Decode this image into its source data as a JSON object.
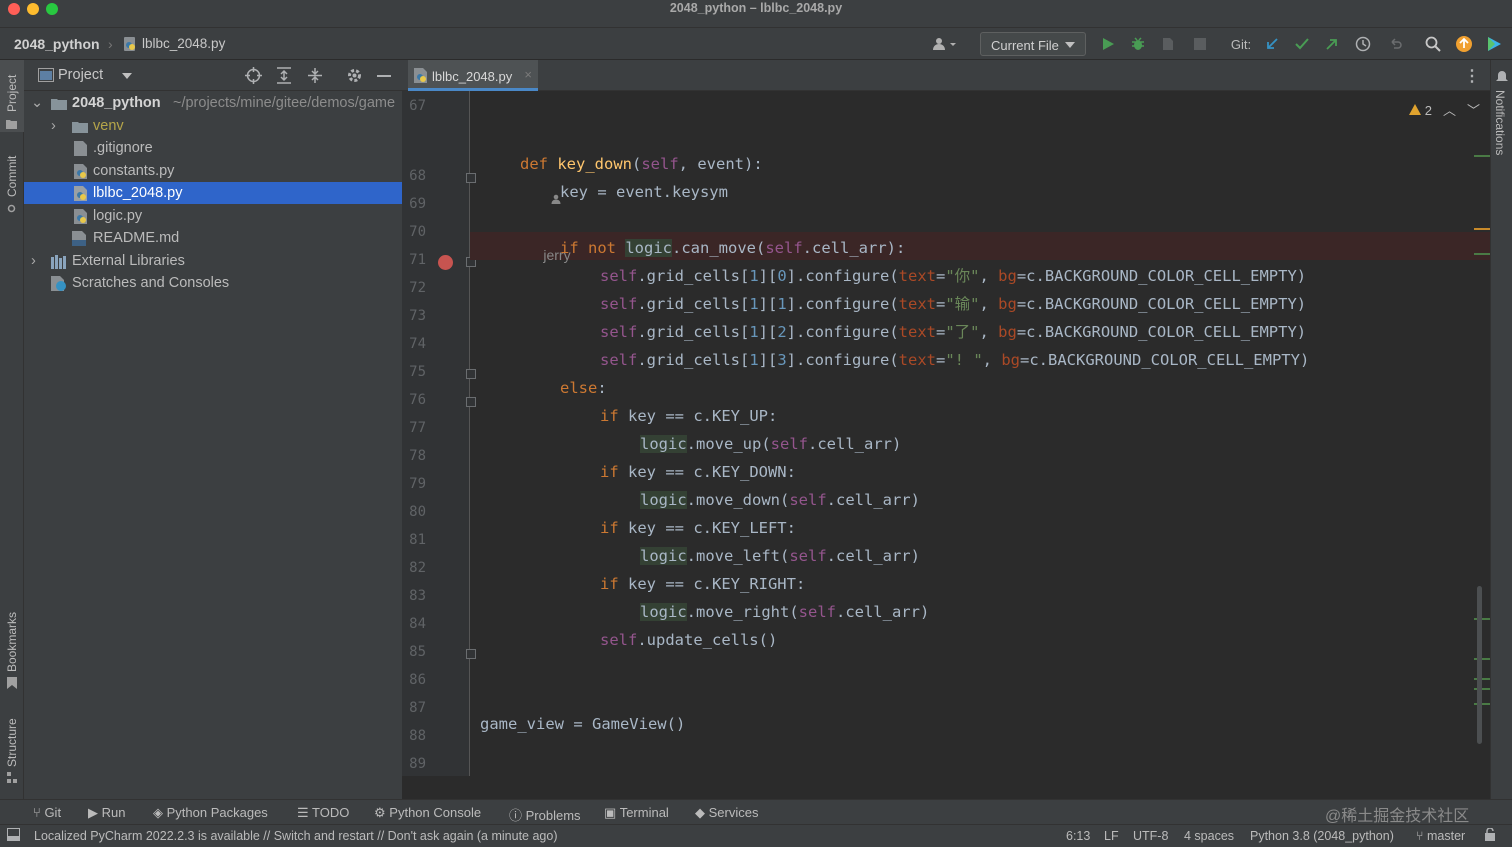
{
  "window": {
    "title": "2048_python – lblbc_2048.py"
  },
  "nav": {
    "project": "2048_python",
    "file": "lblbc_2048.py",
    "run_config": "Current File",
    "git_label": "Git:"
  },
  "project_panel": {
    "title": "Project",
    "tree": [
      {
        "label": "2048_python",
        "path": "~/projects/mine/gitee/demos/game",
        "type": "root"
      },
      {
        "label": "venv",
        "type": "folder"
      },
      {
        "label": ".gitignore",
        "type": "file"
      },
      {
        "label": "constants.py",
        "type": "py"
      },
      {
        "label": "lblbc_2048.py",
        "type": "py",
        "selected": true
      },
      {
        "label": "logic.py",
        "type": "py"
      },
      {
        "label": "README.md",
        "type": "md"
      },
      {
        "label": "External Libraries",
        "type": "lib"
      },
      {
        "label": "Scratches and Consoles",
        "type": "scratch"
      }
    ]
  },
  "left_strip": {
    "project": "Project",
    "commit": "Commit",
    "bookmarks": "Bookmarks",
    "structure": "Structure"
  },
  "right_strip": {
    "notifications": "Notifications"
  },
  "editor": {
    "tab": "lblbc_2048.py",
    "warnings": "2",
    "author_hint": "jerry",
    "line_numbers": [
      "67",
      "68",
      "69",
      "70",
      "71",
      "72",
      "73",
      "74",
      "75",
      "76",
      "77",
      "78",
      "79",
      "80",
      "81",
      "82",
      "83",
      "84",
      "85",
      "86",
      "87",
      "88",
      "89"
    ]
  },
  "tool_windows": [
    "Git",
    "Run",
    "Python Packages",
    "TODO",
    "Python Console",
    "Problems",
    "Terminal",
    "Services"
  ],
  "watermark": "@稀土掘金技术社区",
  "status": {
    "message": "Localized PyCharm 2022.2.3 is available // Switch and restart // Don't ask again (a minute ago)",
    "position": "6:13",
    "line_sep": "LF",
    "encoding": "UTF-8",
    "indent": "4 spaces",
    "interpreter": "Python 3.8 (2048_python)",
    "branch": "master"
  }
}
